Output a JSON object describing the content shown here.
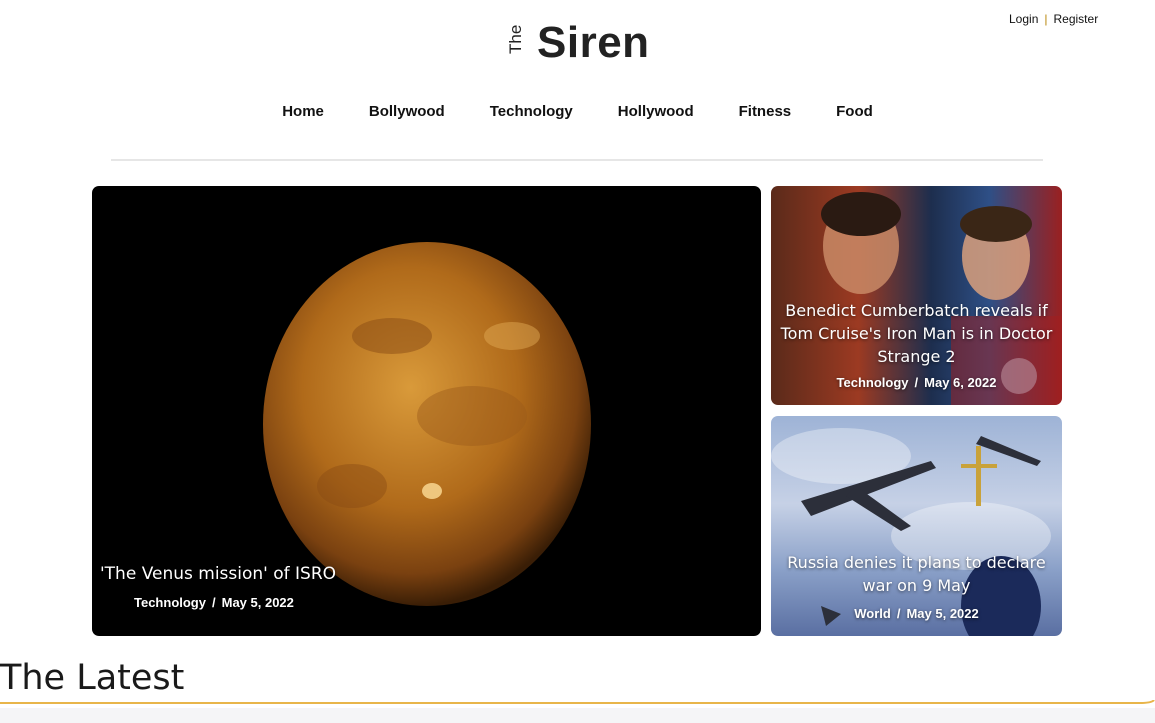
{
  "auth": {
    "login": "Login",
    "separator": "|",
    "register": "Register"
  },
  "logo": {
    "prefix": "The",
    "name": "Siren"
  },
  "nav": [
    "Home",
    "Bollywood",
    "Technology",
    "Hollywood",
    "Fitness",
    "Food"
  ],
  "featured": {
    "main": {
      "title": "'The Venus mission' of ISRO",
      "category": "Technology",
      "date": "May 5, 2022"
    },
    "side": [
      {
        "title": "Benedict Cumberbatch reveals if Tom Cruise's Iron Man is in Doctor Strange 2",
        "category": "Technology",
        "date": "May 6, 2022"
      },
      {
        "title": "Russia denies it plans to declare war on 9 May",
        "category": "World",
        "date": "May 5, 2022"
      }
    ]
  },
  "section": {
    "latest_title": "The Latest"
  },
  "meta_separator": "/",
  "colors": {
    "accent": "#e8b54a",
    "text": "#111111"
  }
}
